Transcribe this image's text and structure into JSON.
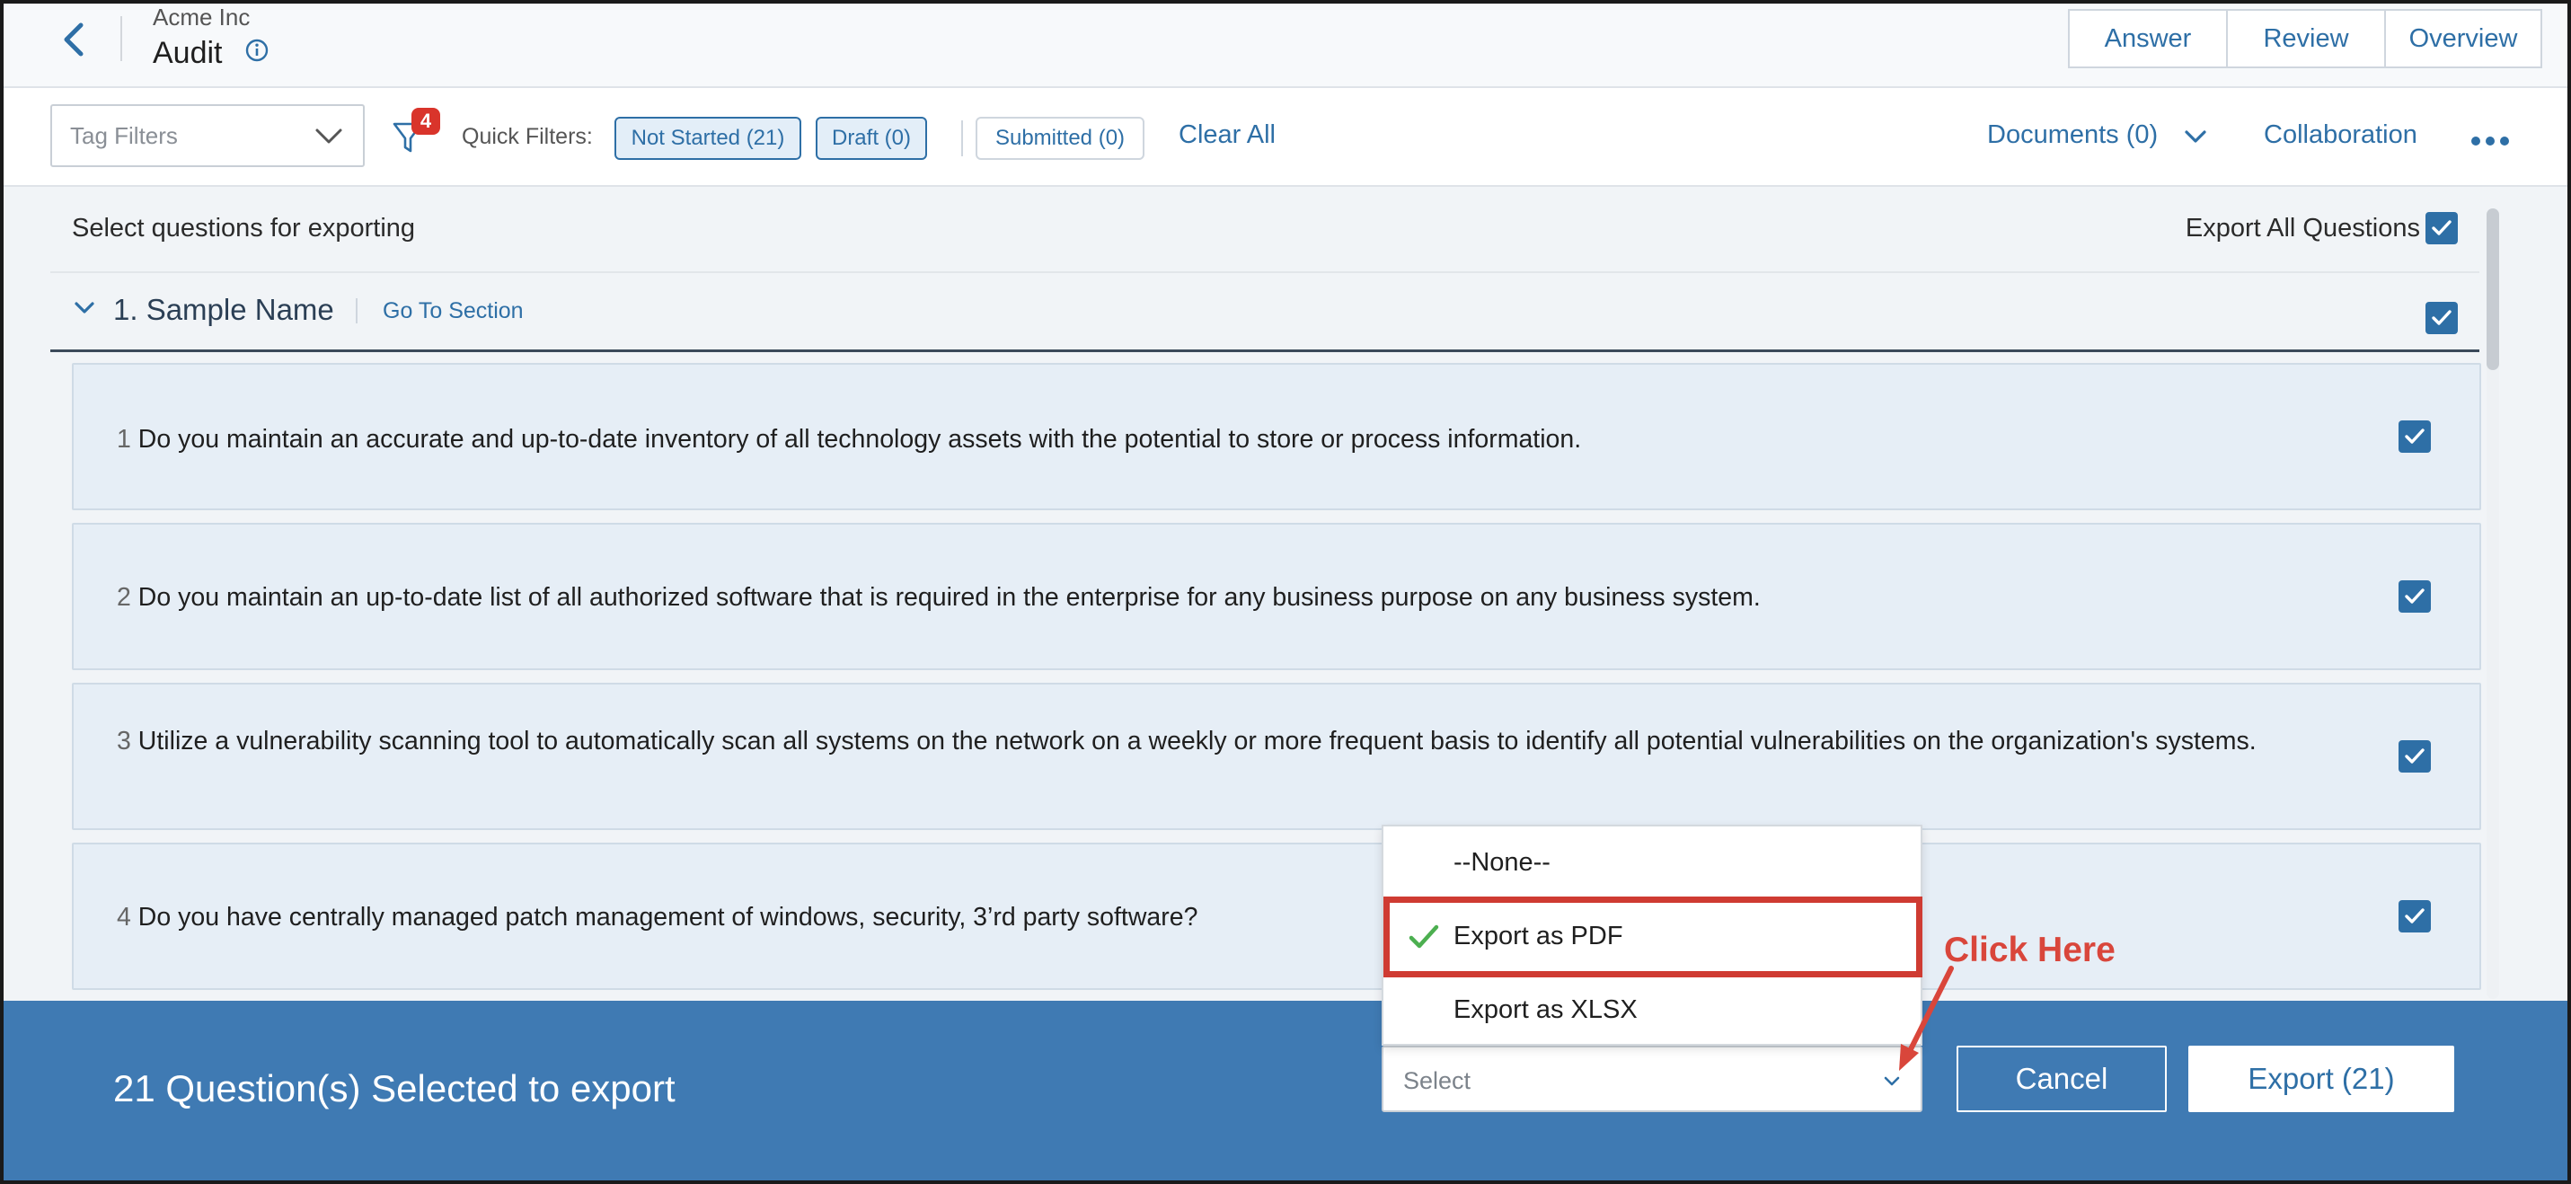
{
  "header": {
    "org_name": "Acme Inc",
    "page_title": "Audit",
    "view_tabs": [
      "Answer",
      "Review",
      "Overview"
    ]
  },
  "filters": {
    "tag_filter_placeholder": "Tag Filters",
    "filter_badge_count": "4",
    "quick_filters_label": "Quick Filters:",
    "chips": [
      {
        "label": "Not Started (21)",
        "selected": true
      },
      {
        "label": "Draft (0)",
        "selected": true
      },
      {
        "label": "Submitted (0)",
        "selected": false
      }
    ],
    "clear_all": "Clear All",
    "documents": "Documents (0)",
    "collaboration": "Collaboration"
  },
  "content": {
    "select_prompt": "Select questions for exporting",
    "export_all_label": "Export All Questions",
    "export_all_checked": true,
    "section": {
      "title": "1. Sample Name",
      "goto": "Go To Section",
      "checked": true
    },
    "questions": [
      {
        "num": "1",
        "text": "Do you maintain an accurate and up-to-date inventory of all technology assets with the potential to store or process information.",
        "checked": true
      },
      {
        "num": "2",
        "text": "Do you maintain an up-to-date list of all authorized software that is required in the enterprise for any business purpose on any business system.",
        "checked": true
      },
      {
        "num": "3",
        "text": "Utilize a vulnerability scanning tool to automatically scan all systems on the network on a weekly or more frequent basis to identify all potential vulnerabilities on the organization's systems.",
        "checked": true
      },
      {
        "num": "4",
        "text": "Do you have centrally managed patch management of windows, security, 3’rd party software?",
        "checked": true
      }
    ]
  },
  "footer": {
    "selected_count_text": "21 Question(s) Selected to export",
    "select_placeholder": "Select",
    "cancel": "Cancel",
    "export": "Export (21)"
  },
  "dropdown": {
    "options": [
      "--None--",
      "Export as PDF",
      "Export as XLSX"
    ],
    "checked_option": "Export as PDF"
  },
  "annotation": {
    "callout_text": "Click Here",
    "accent_color": "#cf3b32"
  },
  "colors": {
    "brand_blue": "#2e6fa6",
    "footer_blue": "#3f7ab3",
    "card_bg": "#e6eef6",
    "badge_red": "#d9342b",
    "check_green": "#4caf50"
  }
}
